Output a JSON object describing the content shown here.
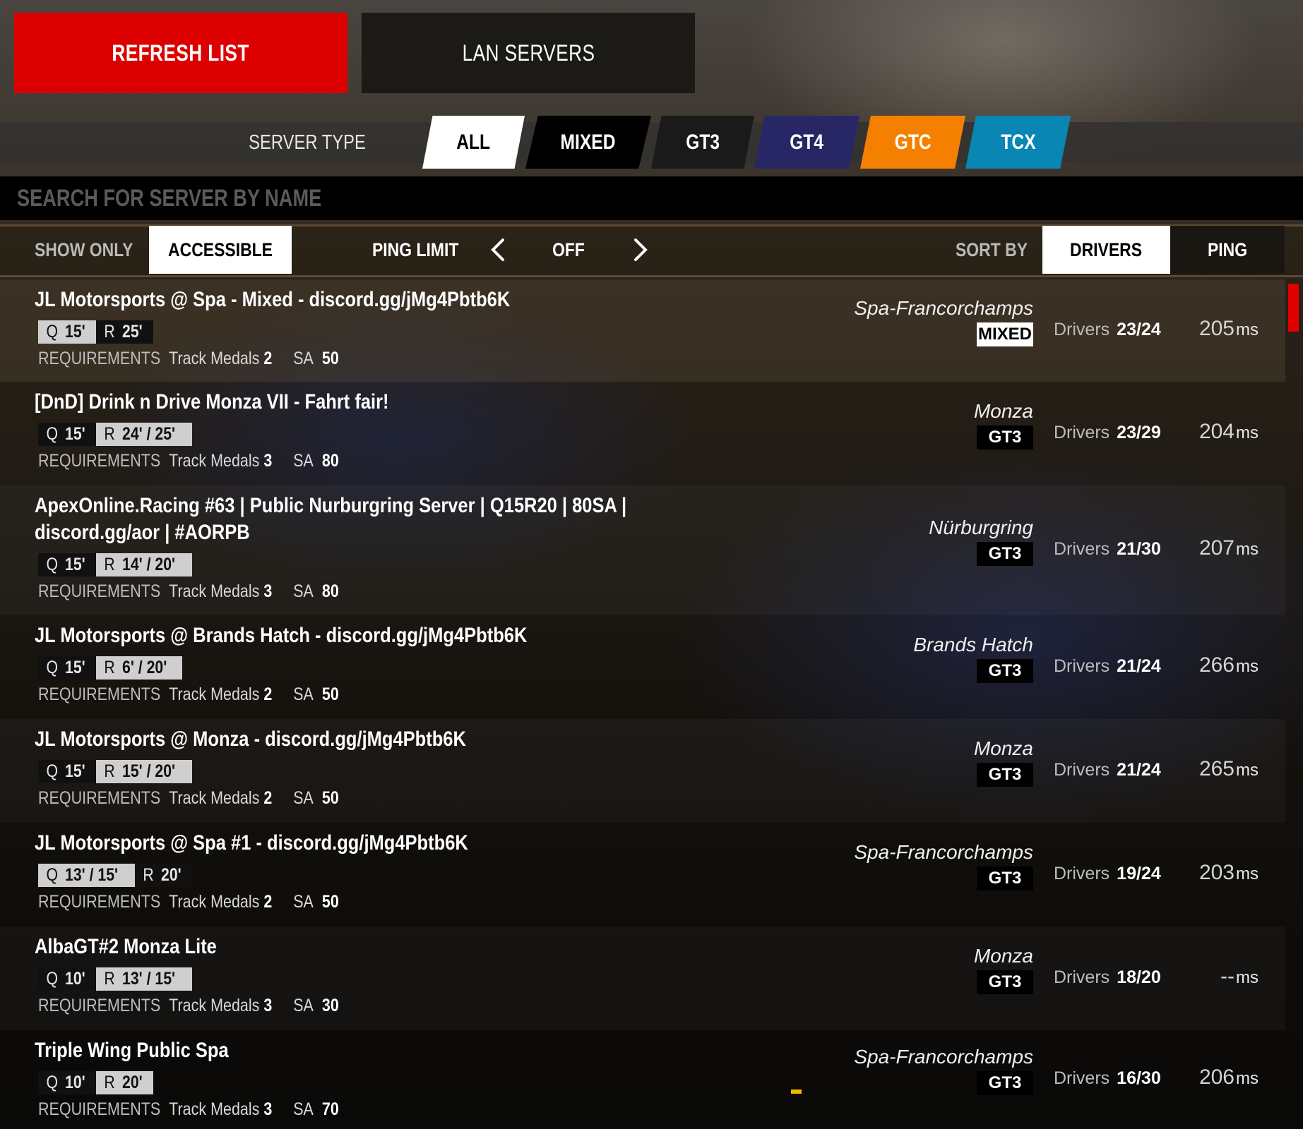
{
  "top_buttons": {
    "refresh": "REFRESH LIST",
    "lan": "LAN SERVERS"
  },
  "server_type": {
    "label": "SERVER TYPE",
    "selected": "ALL",
    "tabs": [
      {
        "label": "ALL",
        "bg": "#ffffff",
        "fg": "#000000"
      },
      {
        "label": "MIXED",
        "bg": "#000000",
        "fg": "#ffffff"
      },
      {
        "label": "GT3",
        "bg": "#1a1a1a",
        "fg": "#ffffff"
      },
      {
        "label": "GT4",
        "bg": "#272766",
        "fg": "#ffffff"
      },
      {
        "label": "GTC",
        "bg": "#f58000",
        "fg": "#ffffff"
      },
      {
        "label": "TCX",
        "bg": "#0a86b4",
        "fg": "#ffffff"
      }
    ]
  },
  "search": {
    "placeholder": "SEARCH FOR SERVER BY NAME",
    "value": ""
  },
  "filters": {
    "show_only_label": "SHOW ONLY",
    "show_only_value": "ACCESSIBLE",
    "ping_limit_label": "PING LIMIT",
    "ping_limit_value": "OFF",
    "sort_by_label": "SORT BY",
    "sort_options": [
      "DRIVERS",
      "PING"
    ],
    "sort_selected": "DRIVERS"
  },
  "labels": {
    "requirements": "REQUIREMENTS",
    "track_medals": "Track Medals",
    "sa": "SA",
    "drivers": "Drivers",
    "ms": "ms"
  },
  "colors": {
    "accent_red": "#dd0000",
    "loading_indicator": "#f5b800"
  },
  "servers": [
    {
      "name": "JL Motorsports @ Spa - Mixed - discord.gg/jMg4Pbtb6K",
      "sessions": [
        {
          "k": "Q",
          "v": "15'",
          "active": true
        },
        {
          "k": "R",
          "v": "25'",
          "active": false
        }
      ],
      "track_medals": "2",
      "sa": "50",
      "track": "Spa-Francorchamps",
      "class": "MIXED",
      "drivers": "23/24",
      "ping": "205"
    },
    {
      "name": "[DnD] Drink n Drive Monza  VII - Fahrt fair!",
      "sessions": [
        {
          "k": "Q",
          "v": "15'",
          "active": false
        },
        {
          "k": "R",
          "v": "24' / 25'",
          "active": true
        }
      ],
      "track_medals": "3",
      "sa": "80",
      "track": "Monza",
      "class": "GT3",
      "drivers": "23/29",
      "ping": "204"
    },
    {
      "name": "ApexOnline.Racing #63 | Public Nurburgring Server | Q15R20 | 80SA | discord.gg/aor | #AORPB",
      "sessions": [
        {
          "k": "Q",
          "v": "15'",
          "active": false
        },
        {
          "k": "R",
          "v": "14' / 20'",
          "active": true
        }
      ],
      "track_medals": "3",
      "sa": "80",
      "track": "Nürburgring",
      "class": "GT3",
      "drivers": "21/30",
      "ping": "207"
    },
    {
      "name": "JL Motorsports @ Brands Hatch - discord.gg/jMg4Pbtb6K",
      "sessions": [
        {
          "k": "Q",
          "v": "15'",
          "active": false
        },
        {
          "k": "R",
          "v": "6' / 20'",
          "active": true
        }
      ],
      "track_medals": "2",
      "sa": "50",
      "track": "Brands Hatch",
      "class": "GT3",
      "drivers": "21/24",
      "ping": "266"
    },
    {
      "name": "JL Motorsports @ Monza - discord.gg/jMg4Pbtb6K",
      "sessions": [
        {
          "k": "Q",
          "v": "15'",
          "active": false
        },
        {
          "k": "R",
          "v": "15' / 20'",
          "active": true
        }
      ],
      "track_medals": "2",
      "sa": "50",
      "track": "Monza",
      "class": "GT3",
      "drivers": "21/24",
      "ping": "265"
    },
    {
      "name": "JL Motorsports @ Spa #1 - discord.gg/jMg4Pbtb6K",
      "sessions": [
        {
          "k": "Q",
          "v": "13' / 15'",
          "active": true
        },
        {
          "k": "R",
          "v": "20'",
          "active": false
        }
      ],
      "track_medals": "2",
      "sa": "50",
      "track": "Spa-Francorchamps",
      "class": "GT3",
      "drivers": "19/24",
      "ping": "203"
    },
    {
      "name": "AlbaGT#2 Monza Lite",
      "sessions": [
        {
          "k": "Q",
          "v": "10'",
          "active": false
        },
        {
          "k": "R",
          "v": "13' / 15'",
          "active": true
        }
      ],
      "track_medals": "3",
      "sa": "30",
      "track": "Monza",
      "class": "GT3",
      "drivers": "18/20",
      "ping": "--"
    },
    {
      "name": "Triple Wing Public Spa",
      "sessions": [
        {
          "k": "Q",
          "v": "10'",
          "active": false
        },
        {
          "k": "R",
          "v": "20'",
          "active": true
        }
      ],
      "track_medals": "3",
      "sa": "70",
      "track": "Spa-Francorchamps",
      "class": "GT3",
      "drivers": "16/30",
      "ping": "206"
    }
  ]
}
